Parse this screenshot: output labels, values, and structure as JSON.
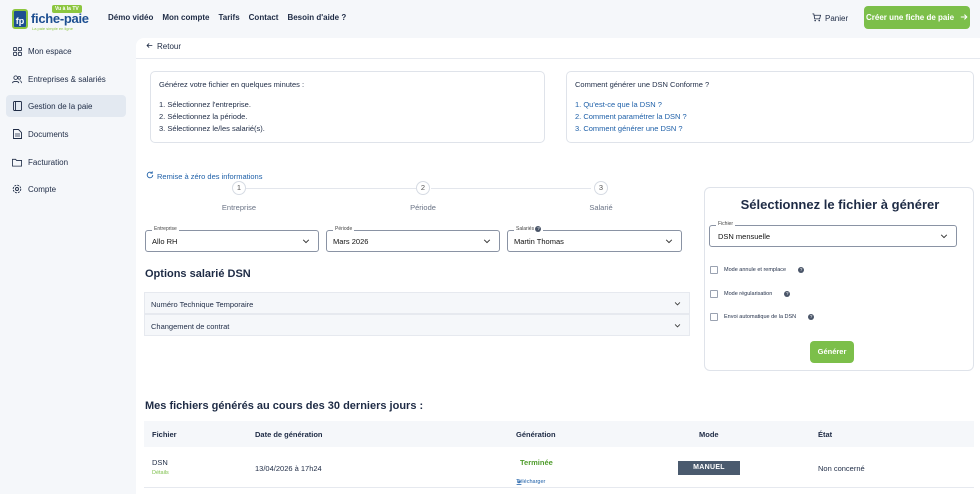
{
  "logo": {
    "brand": "fiche-paie",
    "tag": "Vu à la TV",
    "badge": "fp",
    "slogan": "La paie simple en ligne"
  },
  "nav": {
    "links": [
      "Démo vidéo",
      "Mon compte",
      "Tarifs",
      "Contact",
      "Besoin d'aide ?"
    ],
    "cart_label": "Panier",
    "cta_label": "Créer une fiche de paie"
  },
  "sidebar": {
    "items": [
      {
        "label": "Mon espace",
        "icon": "grid-icon"
      },
      {
        "label": "Entreprises & salariés",
        "icon": "users-icon"
      },
      {
        "label": "Gestion de la paie",
        "icon": "book-icon",
        "active": true
      },
      {
        "label": "Documents",
        "icon": "document-icon"
      },
      {
        "label": "Facturation",
        "icon": "folder-icon"
      },
      {
        "label": "Compte",
        "icon": "gear-icon"
      }
    ]
  },
  "main": {
    "back_label": "Retour",
    "intro": {
      "head": "Générez votre fichier en quelques minutes :",
      "steps": [
        "1. Sélectionnez l'entreprise.",
        "2. Sélectionnez la période.",
        "3. Sélectionnez le/les salarié(s)."
      ]
    },
    "help": {
      "head": "Comment générer une DSN Conforme ?",
      "links": [
        "1. Qu'est-ce que la DSN ?",
        "2. Comment paramétrer la DSN ?",
        "3. Comment générer une DSN ?"
      ]
    },
    "reset_label": "Remise à zéro des informations",
    "stepper": [
      {
        "num": "1",
        "label": "Entreprise"
      },
      {
        "num": "2",
        "label": "Période"
      },
      {
        "num": "3",
        "label": "Salarié"
      }
    ],
    "fields": {
      "entreprise": {
        "label": "Entreprise",
        "value": "Allo RH"
      },
      "periode": {
        "label": "Période",
        "value": "Mars 2026"
      },
      "salaries": {
        "label": "Salariés",
        "value": "Martin Thomas"
      }
    },
    "options_title": "Options salarié DSN",
    "accordions": [
      "Numéro Technique Temporaire",
      "Changement de contrat"
    ]
  },
  "generator": {
    "title": "Sélectionnez le fichier à générer",
    "file_label": "Fichier",
    "file_value": "DSN mensuelle",
    "checks": [
      "Mode annule et remplace",
      "Mode régularisation",
      "Envoi automatique de la DSN"
    ],
    "button": "Générer"
  },
  "files": {
    "title": "Mes fichiers générés au cours des 30 derniers jours :",
    "columns": [
      "Fichier",
      "Date de génération",
      "Génération",
      "Mode",
      "État"
    ],
    "rows": [
      {
        "file": "DSN",
        "details": "Détails",
        "date": "13/04/2026 à 17h24",
        "status": "Terminée",
        "download": "Télécharger",
        "mode": "MANUEL",
        "state": "Non concerné"
      }
    ]
  },
  "colors": {
    "accent_green": "#7cbf4a",
    "brand_blue": "#1d4f91",
    "link_blue": "#1d5fa8"
  }
}
